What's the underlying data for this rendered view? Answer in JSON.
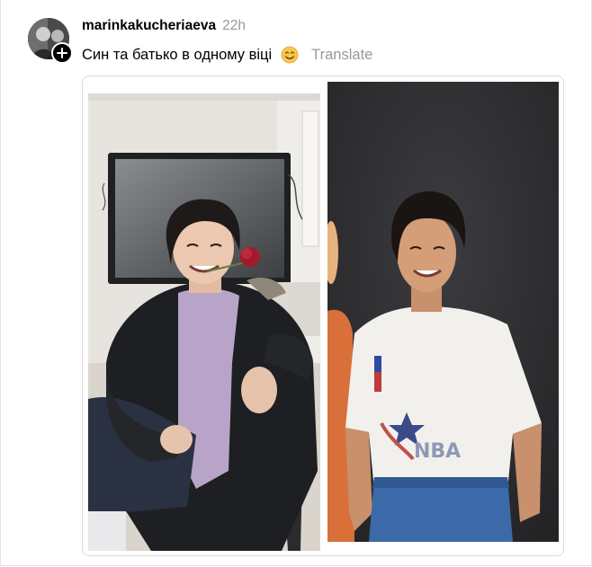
{
  "post": {
    "username": "marinkakucheriaeva",
    "timestamp": "22h",
    "caption": "Син та батько в одному віці",
    "translate_label": "Translate"
  },
  "icons": {
    "avatar": "profile-photo",
    "follow": "plus-icon",
    "emoji": "smiling-face-emoji"
  },
  "colors": {
    "text": "#000000",
    "muted": "#999999",
    "border": "#dcdcdc"
  }
}
